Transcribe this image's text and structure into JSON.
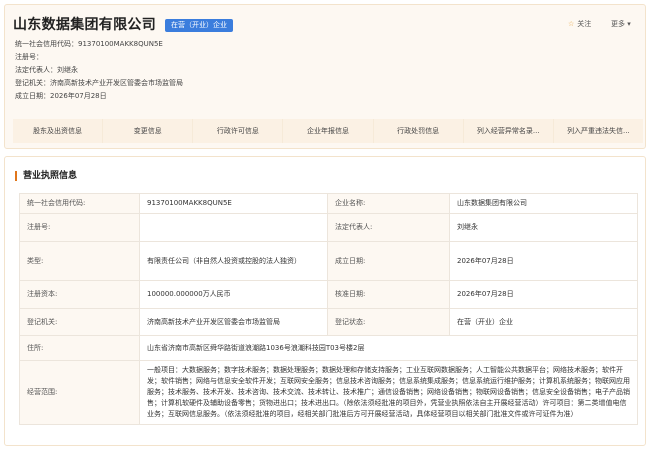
{
  "company": {
    "name": "山东数据集团有限公司",
    "status_badge": "在营（开业）企业",
    "follow_label": "关注",
    "more_label": "更多",
    "credit_code_label": "统一社会信用代码：",
    "credit_code": "91370100MAKK8QUN5E",
    "reg_no_label": "注册号：",
    "reg_no": "",
    "legal_rep_label": "法定代表人：",
    "legal_rep": "刘继永",
    "authority_label": "登记机关：",
    "authority": "济南高新技术产业开发区管委会市场监管局",
    "est_date_label": "成立日期：",
    "est_date": "2026年07月28日"
  },
  "tabs": [
    {
      "label": "股东及出资信息"
    },
    {
      "label": "变更信息"
    },
    {
      "label": "行政许可信息"
    },
    {
      "label": "企业年报信息"
    },
    {
      "label": "行政处罚信息"
    },
    {
      "label": "列入经营异常名录..."
    },
    {
      "label": "列入严重违法失信..."
    }
  ],
  "license": {
    "title": "营业执照信息",
    "rows": [
      {
        "l1": "统一社会信用代码:",
        "v1": "91370100MAKK8QUN5E",
        "l2": "企业名称:",
        "v2": "山东数据集团有限公司"
      },
      {
        "l1": "注册号:",
        "v1": "",
        "l2": "法定代表人:",
        "v2": "刘继永"
      },
      {
        "l1": "类型:",
        "v1": "有限责任公司（非自然人投资或控股的法人独资）",
        "l2": "成立日期:",
        "v2": "2026年07月28日"
      },
      {
        "l1": "注册资本:",
        "v1": "100000.000000万人民币",
        "l2": "核准日期:",
        "v2": "2026年07月28日"
      },
      {
        "l1": "登记机关:",
        "v1": "济南高新技术产业开发区管委会市场监管局",
        "l2": "登记状态:",
        "v2": "在营（开业）企业"
      }
    ],
    "address_label": "住所:",
    "address": "山东省济南市高新区舜华路街道浪潮路1036号浪潮科技园T03号楼2层",
    "scope_label": "经营范围:",
    "scope": "一般项目：大数据服务；数字技术服务；数据处理服务；数据处理和存储支持服务；工业互联网数据服务；人工智能公共数据平台；网络技术服务；软件开发；软件销售；网络与信息安全软件开发；互联网安全服务；信息技术咨询服务；信息系统集成服务；信息系统运行维护服务；计算机系统服务；物联网应用服务；技术服务、技术开发、技术咨询、技术交流、技术转让、技术推广；通信设备销售；网络设备销售；物联网设备销售；信息安全设备销售；电子产品销售；计算机软硬件及辅助设备零售；货物进出口；技术进出口。（除依法须经批准的项目外，凭营业执照依法自主开展经营活动）许可项目：第二类增值电信业务；互联网信息服务。（依法须经批准的项目，经相关部门批准后方可开展经营活动，具体经营项目以相关部门批准文件或许可证件为准）"
  }
}
